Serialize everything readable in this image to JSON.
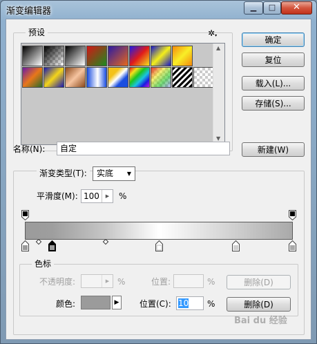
{
  "window": {
    "title": "渐变编辑器"
  },
  "presets": {
    "label": "预设",
    "swatch_count": 16
  },
  "buttons": {
    "ok": "确定",
    "reset": "复位",
    "load": "载入(L)...",
    "save": "存储(S)...",
    "new": "新建(W)",
    "delete_opacity": "删除(D)",
    "delete_color": "删除(D)"
  },
  "name": {
    "label": "名称(N):",
    "value": "自定"
  },
  "gradient_type": {
    "label": "渐变类型(T):",
    "value": "实底"
  },
  "smoothness": {
    "label": "平滑度(M):",
    "value": "100",
    "unit": "%"
  },
  "stops": {
    "label": "色标",
    "opacity_label": "不透明度:",
    "opacity_unit": "%",
    "opacity_position_label": "位置:",
    "opacity_position_unit": "%",
    "color_label": "颜色:",
    "color_swatch": "#9b9b9b",
    "color_position_label": "位置(C):",
    "color_position_value": "10",
    "color_position_unit": "%"
  },
  "watermark": "Bai du 经验"
}
